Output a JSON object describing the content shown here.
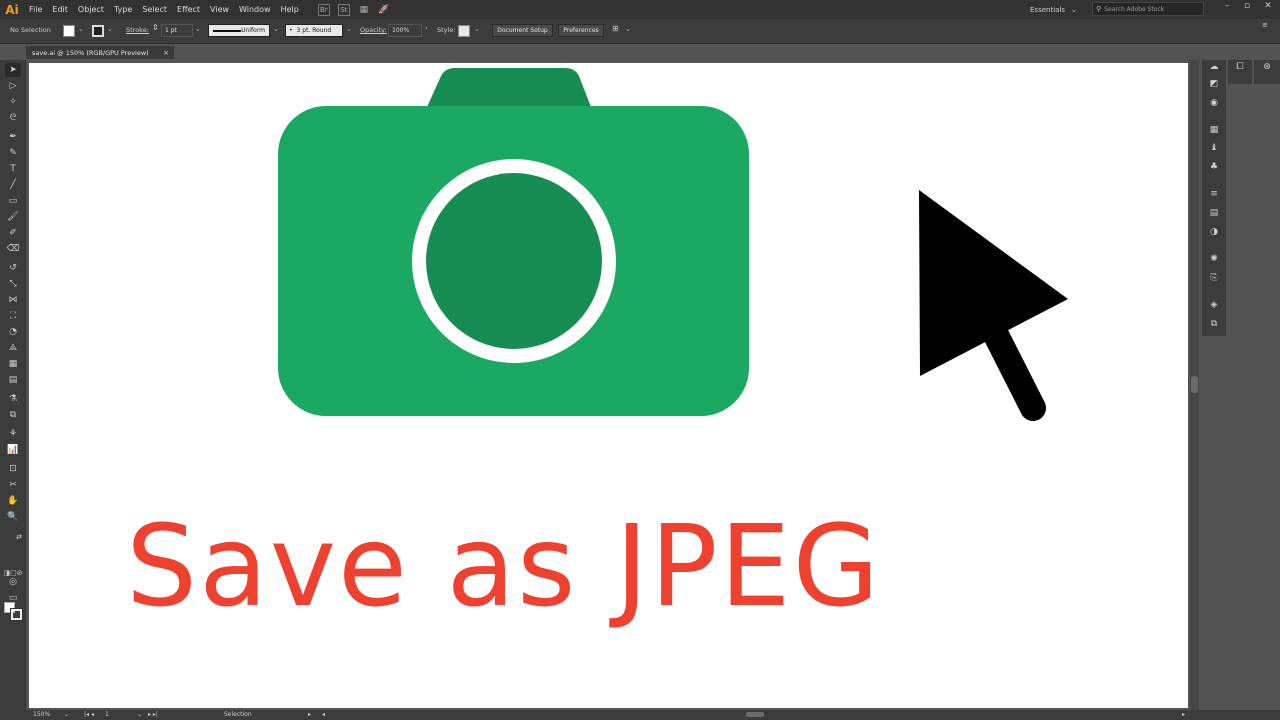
{
  "app": {
    "logo": "Ai",
    "menu": [
      "File",
      "Edit",
      "Object",
      "Type",
      "Select",
      "Effect",
      "View",
      "Window",
      "Help"
    ],
    "menubar_icons": [
      "Br",
      "St"
    ],
    "workspace": "Essentials",
    "search_placeholder": "Search Adobe Stock"
  },
  "controlbar": {
    "selection_state": "No Selection",
    "stroke_label": "Stroke:",
    "stroke_weight": "1 pt",
    "stroke_profile": "Uniform",
    "brush": "3 pt. Round",
    "opacity_label": "Opacity:",
    "opacity_value": "100%",
    "style_label": "Style:",
    "document_setup_button": "Document Setup",
    "preferences_button": "Preferences"
  },
  "document": {
    "tab_title": "save.ai @ 150% (RGB/GPU Preview)",
    "close_glyph": "×"
  },
  "artwork": {
    "headline": "Save as JPEG",
    "colors": {
      "camera_body": "#1aa863",
      "camera_dark": "#178d53",
      "ring": "#ffffff",
      "cursor": "#000000",
      "headline": "#ee4130"
    }
  },
  "statusbar": {
    "zoom": "150%",
    "artboard_number": "1",
    "tool_name": "Selection"
  },
  "colors": {
    "ui_dark": "#323232",
    "ui_panel": "#3c3c3c",
    "pasteboard": "#535353"
  }
}
